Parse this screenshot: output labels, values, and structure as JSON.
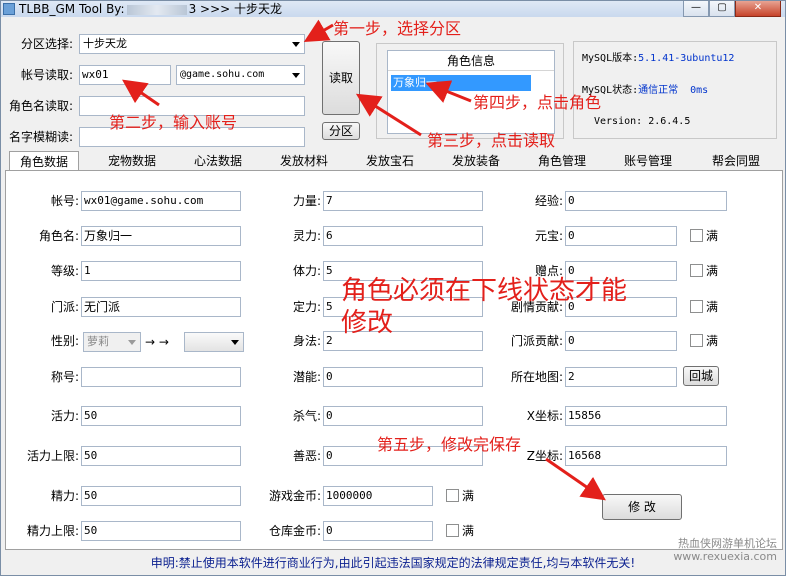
{
  "window": {
    "title_prefix": "TLBB_GM Tool By:",
    "title_mid": "3 >>> ",
    "title_server": "十步天龙",
    "min": "—",
    "max": "▢",
    "close": "✕"
  },
  "top": {
    "zone_label": "分区选择:",
    "zone_value": "十步天龙",
    "account_label": "帐号读取:",
    "account_value": "wx01",
    "domain_value": "@game.sohu.com",
    "role_label": "角色名读取:",
    "fuzzy_label": "名字模糊读:",
    "read_button": "读取",
    "zone_button": "分区",
    "role_info_header": "角色信息",
    "role_selected": "万象归一"
  },
  "mysql": {
    "version_label": "MySQL版本:",
    "version_value": "5.1.41-3ubuntu12",
    "status_label": "MySQL状态:",
    "status_value": "通信正常",
    "latency": "0ms",
    "app_version_label": "Version:",
    "app_version_value": "2.6.4.5"
  },
  "tabs": [
    "角色数据",
    "宠物数据",
    "心法数据",
    "发放材料",
    "发放宝石",
    "发放装备",
    "角色管理",
    "账号管理",
    "帮会同盟"
  ],
  "form": {
    "account_label": "帐号:",
    "account": "wx01@game.sohu.com",
    "name_label": "角色名:",
    "name": "万象归一",
    "level_label": "等级:",
    "level": "1",
    "school_label": "门派:",
    "school": "无门派",
    "gender_label": "性别:",
    "gender": "萝莉",
    "arrows": "→ →",
    "title_label": "称号:",
    "vitality_label": "活力:",
    "vitality": "50",
    "vitality_max_label": "活力上限:",
    "vitality_max": "50",
    "energy_label": "精力:",
    "energy": "50",
    "energy_max_label": "精力上限:",
    "energy_max": "50",
    "str_label": "力量:",
    "str": "7",
    "spr_label": "灵力:",
    "spr": "6",
    "con_label": "体力:",
    "con": "5",
    "int_label": "定力:",
    "int": "5",
    "agi_label": "身法:",
    "agi": "2",
    "pot_label": "潜能:",
    "pot": "0",
    "kill_label": "杀气:",
    "kill": "0",
    "moral_label": "善恶:",
    "moral": "0",
    "gold_label": "游戏金币:",
    "gold": "1000000",
    "bank_label": "仓库金币:",
    "bank": "0",
    "exp_label": "经验:",
    "exp": "0",
    "yuanbao_label": "元宝:",
    "yuanbao": "0",
    "gift_label": "赠点:",
    "gift": "0",
    "plot_label": "剧情贡献:",
    "plot": "0",
    "school_contrib_label": "门派贡献:",
    "school_contrib": "0",
    "map_label": "所在地图:",
    "map": "2",
    "x_label": "X坐标:",
    "x": "15856",
    "z_label": "Z坐标:",
    "z": "16568",
    "full": "满",
    "return_city_button": "回城",
    "modify_button": "修 改"
  },
  "annotations": {
    "step1": "第一步，选择分区",
    "step2": "第二步，输入账号",
    "step3": "第三步，点击读取",
    "step4": "第四步，点击角色",
    "step5": "第五步，修改完保存",
    "note": "角色必须在下线状态才能修改"
  },
  "footer": "申明:禁止使用本软件进行商业行为,由此引起违法国家规定的法律规定责任,均与本软件无关!",
  "watermark": {
    "line1": "热血侠网游单机论坛",
    "line2": "www.rexuexia.com"
  },
  "colors": {
    "annotation": "#e3201b",
    "footer": "#0a1f8f",
    "status": "#0033cc",
    "selection": "#3399ff"
  }
}
